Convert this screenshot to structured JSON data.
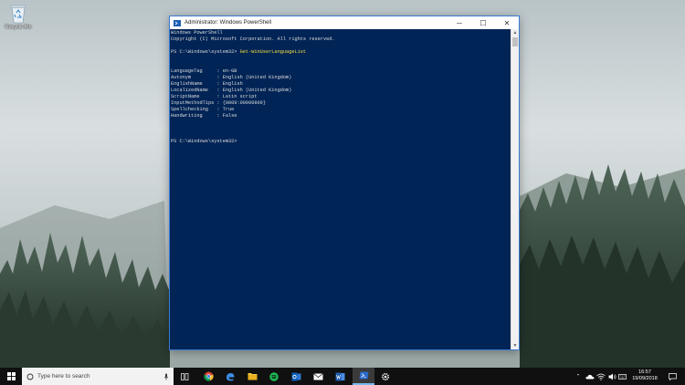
{
  "desktop": {
    "recycle_bin_label": "Recycle Bin"
  },
  "window": {
    "title": "Administrator: Windows PowerShell",
    "minimize": "─",
    "maximize": "☐",
    "close": "✕",
    "console_lines": [
      {
        "text": "Windows PowerShell",
        "cmd": ""
      },
      {
        "text": "Copyright (C) Microsoft Corporation. All rights reserved.",
        "cmd": ""
      },
      {
        "text": "",
        "cmd": ""
      },
      {
        "text": "PS C:\\Windows\\system32> ",
        "cmd": "Get-WinUserLanguageList"
      },
      {
        "text": "",
        "cmd": ""
      },
      {
        "text": "",
        "cmd": ""
      },
      {
        "text": "LanguageTag     : en-GB",
        "cmd": ""
      },
      {
        "text": "Autonym         : English (United Kingdom)",
        "cmd": ""
      },
      {
        "text": "EnglishName     : English",
        "cmd": ""
      },
      {
        "text": "LocalizedName   : English (United Kingdom)",
        "cmd": ""
      },
      {
        "text": "ScriptName      : Latin script",
        "cmd": ""
      },
      {
        "text": "InputMethodTips : {0809:00000809}",
        "cmd": ""
      },
      {
        "text": "Spellchecking   : True",
        "cmd": ""
      },
      {
        "text": "Handwriting     : False",
        "cmd": ""
      },
      {
        "text": "",
        "cmd": ""
      },
      {
        "text": "",
        "cmd": ""
      },
      {
        "text": "",
        "cmd": ""
      },
      {
        "text": "PS C:\\Windows\\system32>",
        "cmd": ""
      }
    ],
    "console_background": "#012456",
    "command_color": "#f3e23f"
  },
  "taskbar": {
    "search_placeholder": "Type here to search",
    "apps": [
      {
        "name": "task-view",
        "icon": "task-view-icon",
        "active": false
      },
      {
        "name": "chrome",
        "icon": "chrome-icon",
        "active": false
      },
      {
        "name": "edge",
        "icon": "edge-icon",
        "active": false
      },
      {
        "name": "file-explorer",
        "icon": "folder-icon",
        "active": false
      },
      {
        "name": "spotify",
        "icon": "spotify-icon",
        "active": false
      },
      {
        "name": "outlook",
        "icon": "outlook-icon",
        "active": false
      },
      {
        "name": "mail",
        "icon": "mail-icon",
        "active": false
      },
      {
        "name": "word",
        "icon": "word-icon",
        "active": false
      },
      {
        "name": "powershell",
        "icon": "powershell-icon",
        "active": true
      },
      {
        "name": "settings",
        "icon": "gear-icon",
        "active": false
      }
    ],
    "clock_time": "16:57",
    "clock_date": "19/09/2018"
  }
}
